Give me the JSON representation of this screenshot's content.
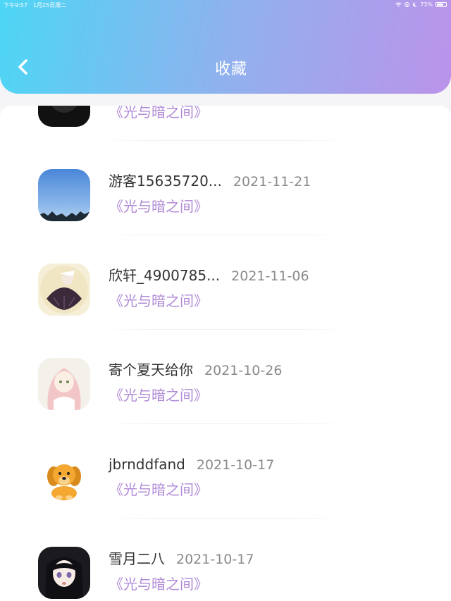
{
  "status_bar": {
    "time": "下午9:57",
    "date": "1月25日周二",
    "battery": "73%",
    "battery_level": 0.73
  },
  "header": {
    "title": "收藏",
    "back_icon": "chevron-left-icon"
  },
  "favorites": [
    {
      "user": "",
      "date": "",
      "book": "《光与暗之间》",
      "avatar": "dark-avatar"
    },
    {
      "user": "游客15635720...",
      "date": "2021-11-21",
      "book": "《光与暗之间》",
      "avatar": "sky-avatar"
    },
    {
      "user": "欣轩_4900785...",
      "date": "2021-11-06",
      "book": "《光与暗之间》",
      "avatar": "dark-dress-girl-avatar"
    },
    {
      "user": "寄个夏天给你",
      "date": "2021-10-26",
      "book": "《光与暗之间》",
      "avatar": "pink-hair-girl-avatar"
    },
    {
      "user": "jbrnddfand",
      "date": "2021-10-17",
      "book": "《光与暗之间》",
      "avatar": "puppy-avatar"
    },
    {
      "user": "雪月二八",
      "date": "2021-10-17",
      "book": "《光与暗之间》",
      "avatar": "dark-hair-girl-avatar"
    }
  ],
  "colors": {
    "header_gradient_start": "#4dd6f5",
    "header_gradient_end": "#bb93ea",
    "book_title": "#b08ad6",
    "date_text": "#8a8a8a"
  }
}
